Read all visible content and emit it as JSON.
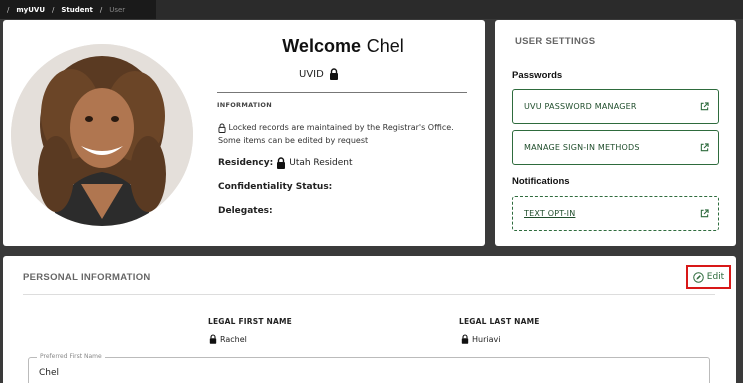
{
  "breadcrumb": {
    "items": [
      "myUVU",
      "Student"
    ],
    "current": "User"
  },
  "profile": {
    "welcome_prefix": "Welcome",
    "name": "Chel",
    "uvid_label": "UVID",
    "info_heading": "INFORMATION",
    "locked_note": "Locked records are maintained by the Registrar's Office. Some items can be edited by request",
    "residency_label": "Residency:",
    "residency_value": "Utah Resident",
    "confidentiality_label": "Confidentiality Status:",
    "delegates_label": "Delegates:"
  },
  "settings": {
    "title": "USER SETTINGS",
    "passwords_label": "Passwords",
    "password_manager": "UVU PASSWORD MANAGER",
    "sign_in_methods": "MANAGE SIGN-IN METHODS",
    "notifications_label": "Notifications",
    "text_opt_in": "TEXT OPT-IN"
  },
  "personal": {
    "title": "PERSONAL INFORMATION",
    "edit_label": "Edit",
    "legal_first_name_label": "LEGAL FIRST NAME",
    "legal_first_name_value": "Rachel",
    "legal_last_name_label": "LEGAL LAST NAME",
    "legal_last_name_value": "Huriavi",
    "preferred_first_name_label": "Preferred First Name",
    "preferred_first_name_value": "Chel"
  },
  "colors": {
    "accent_green": "#2e6b3d",
    "highlight_red": "#d81818",
    "background": "#3a3a3a"
  }
}
